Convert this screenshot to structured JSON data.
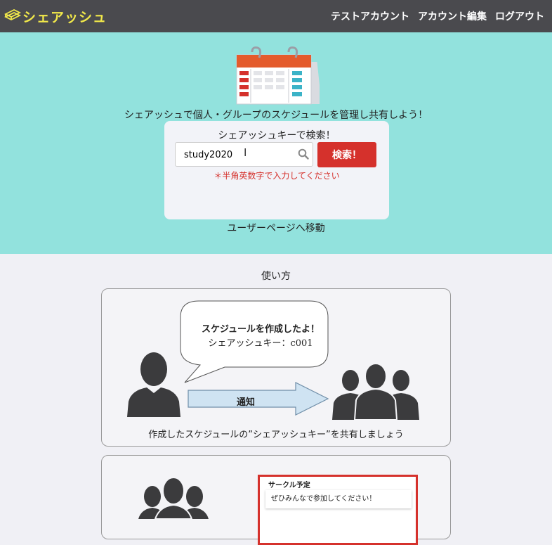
{
  "navbar": {
    "brand": "シェアッシュ",
    "links": [
      "テストアカウント",
      "アカウント編集",
      "ログアウト"
    ]
  },
  "hero": {
    "tagline": "シェアッシュで個人・グループのスケジュールを管理し共有しよう！",
    "search": {
      "title": "シェアッシュキーで検索！",
      "value": "study2020",
      "button": "検索！",
      "hint": "＊半角英数字で入力してください"
    },
    "userpage_link": "ユーザーページへ移動"
  },
  "howto": {
    "title": "使い方",
    "card1": {
      "bubble_line1": "スケジュールを作成したよ！",
      "bubble_line2": "シェアッシュキー：c001",
      "arrow_label": "通知",
      "caption": "作成したスケジュールの”シェアッシュキー”を共有しましょう"
    },
    "card2": {
      "panel_title": "サークル予定",
      "message": "ぜひみんなで参加してください！"
    }
  },
  "colors": {
    "navbar": "#4a4a4e",
    "brand": "#f2e94a",
    "hero": "#92e2dd",
    "accent_red": "#d5312c"
  }
}
